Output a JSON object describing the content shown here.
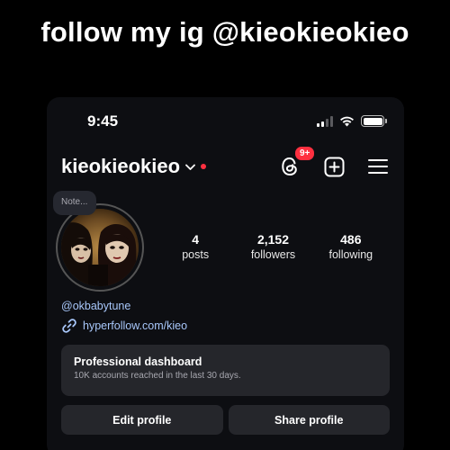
{
  "caption": "follow my ig @kieokieokieo",
  "status_bar": {
    "time": "9:45",
    "battery_level": 1.0,
    "signal_bars": 2
  },
  "header": {
    "username": "kieokieokieo",
    "threads_badge": "9+",
    "accent": "#ff3040"
  },
  "note": {
    "placeholder": "Note..."
  },
  "stats": [
    {
      "value": "4",
      "label": "posts"
    },
    {
      "value": "2,152",
      "label": "followers"
    },
    {
      "value": "486",
      "label": "following"
    }
  ],
  "bio": {
    "handle": "@okbabytune",
    "link": "hyperfollow.com/kieo",
    "link_color": "#a8c7fa"
  },
  "dashboard": {
    "title": "Professional dashboard",
    "subtitle": "10K accounts reached in the last 30 days."
  },
  "buttons": {
    "edit": "Edit profile",
    "share": "Share profile"
  }
}
